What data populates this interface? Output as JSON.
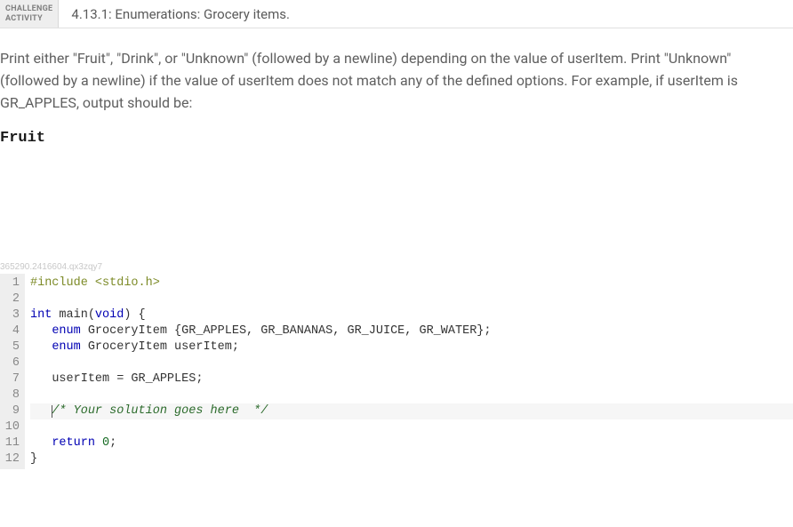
{
  "header": {
    "badge_line1": "CHALLENGE",
    "badge_line2": "ACTIVITY",
    "title": "4.13.1: Enumerations: Grocery items."
  },
  "instructions": "Print either \"Fruit\", \"Drink\", or \"Unknown\" (followed by a newline) depending on the value of userItem. Print \"Unknown\" (followed by a newline) if the value of userItem does not match any of the defined options. For example, if userItem is GR_APPLES, output should be:",
  "example_output": "Fruit",
  "tracking_id": "365290.2416604.qx3zqy7",
  "code_lines": [
    {
      "n": 1,
      "plain": "#include <stdio.h>",
      "highlighted": false
    },
    {
      "n": 2,
      "plain": "",
      "highlighted": false
    },
    {
      "n": 3,
      "plain": "int main(void) {",
      "highlighted": false
    },
    {
      "n": 4,
      "plain": "   enum GroceryItem {GR_APPLES, GR_BANANAS, GR_JUICE, GR_WATER};",
      "highlighted": false
    },
    {
      "n": 5,
      "plain": "   enum GroceryItem userItem;",
      "highlighted": false
    },
    {
      "n": 6,
      "plain": "",
      "highlighted": false
    },
    {
      "n": 7,
      "plain": "   userItem = GR_APPLES;",
      "highlighted": false
    },
    {
      "n": 8,
      "plain": "",
      "highlighted": false
    },
    {
      "n": 9,
      "plain": "   /* Your solution goes here  */",
      "highlighted": true
    },
    {
      "n": 10,
      "plain": "",
      "highlighted": false
    },
    {
      "n": 11,
      "plain": "   return 0;",
      "highlighted": false
    },
    {
      "n": 12,
      "plain": "}",
      "highlighted": false
    }
  ],
  "tokens": {
    "include_directive": "#include",
    "include_header": " <stdio.h>",
    "int_kw": "int",
    "main_sig": " main(",
    "void_kw": "void",
    "main_close": ") {",
    "indent3": "   ",
    "enum_kw": "enum",
    "enum_decl1": " GroceryItem {GR_APPLES, GR_BANANAS, GR_JUICE, GR_WATER};",
    "enum_decl2": " GroceryItem userItem;",
    "assign": "userItem = GR_APPLES;",
    "comment": "/* Your solution goes here  */",
    "return_kw": "return",
    "zero": " 0",
    "semi": ";",
    "close_brace": "}"
  }
}
